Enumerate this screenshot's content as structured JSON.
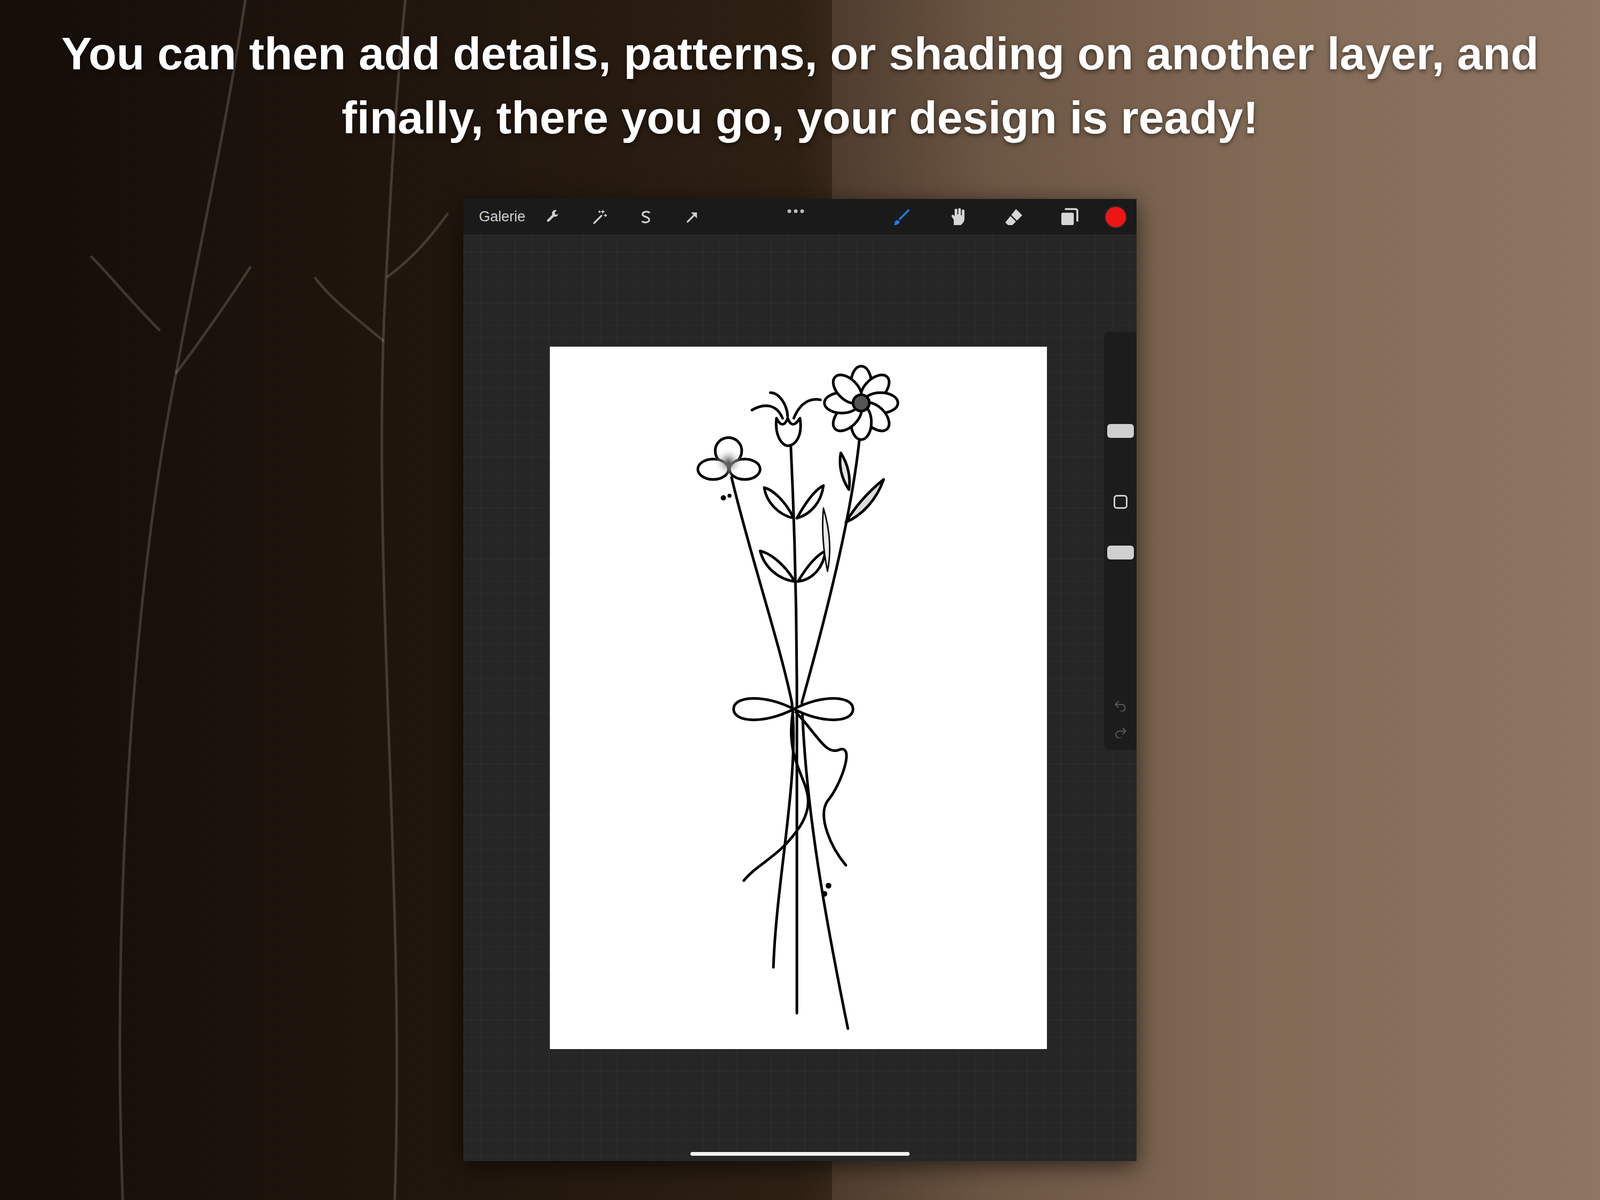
{
  "slide": {
    "caption": "You can then add details, patterns, or shading on another layer, and finally, there you go, your design is ready!"
  },
  "app": {
    "toolbar": {
      "gallery": "Galerie",
      "color": "#f01515",
      "tools": [
        {
          "kind": "brush",
          "selected": true
        },
        {
          "kind": "smudge",
          "selected": false
        },
        {
          "kind": "eraser",
          "selected": false
        },
        {
          "kind": "layers",
          "selected": false
        }
      ]
    },
    "sliders": [
      {
        "kind": "size",
        "level": 0.3
      },
      {
        "kind": "opacity",
        "level": 0.88
      }
    ]
  }
}
